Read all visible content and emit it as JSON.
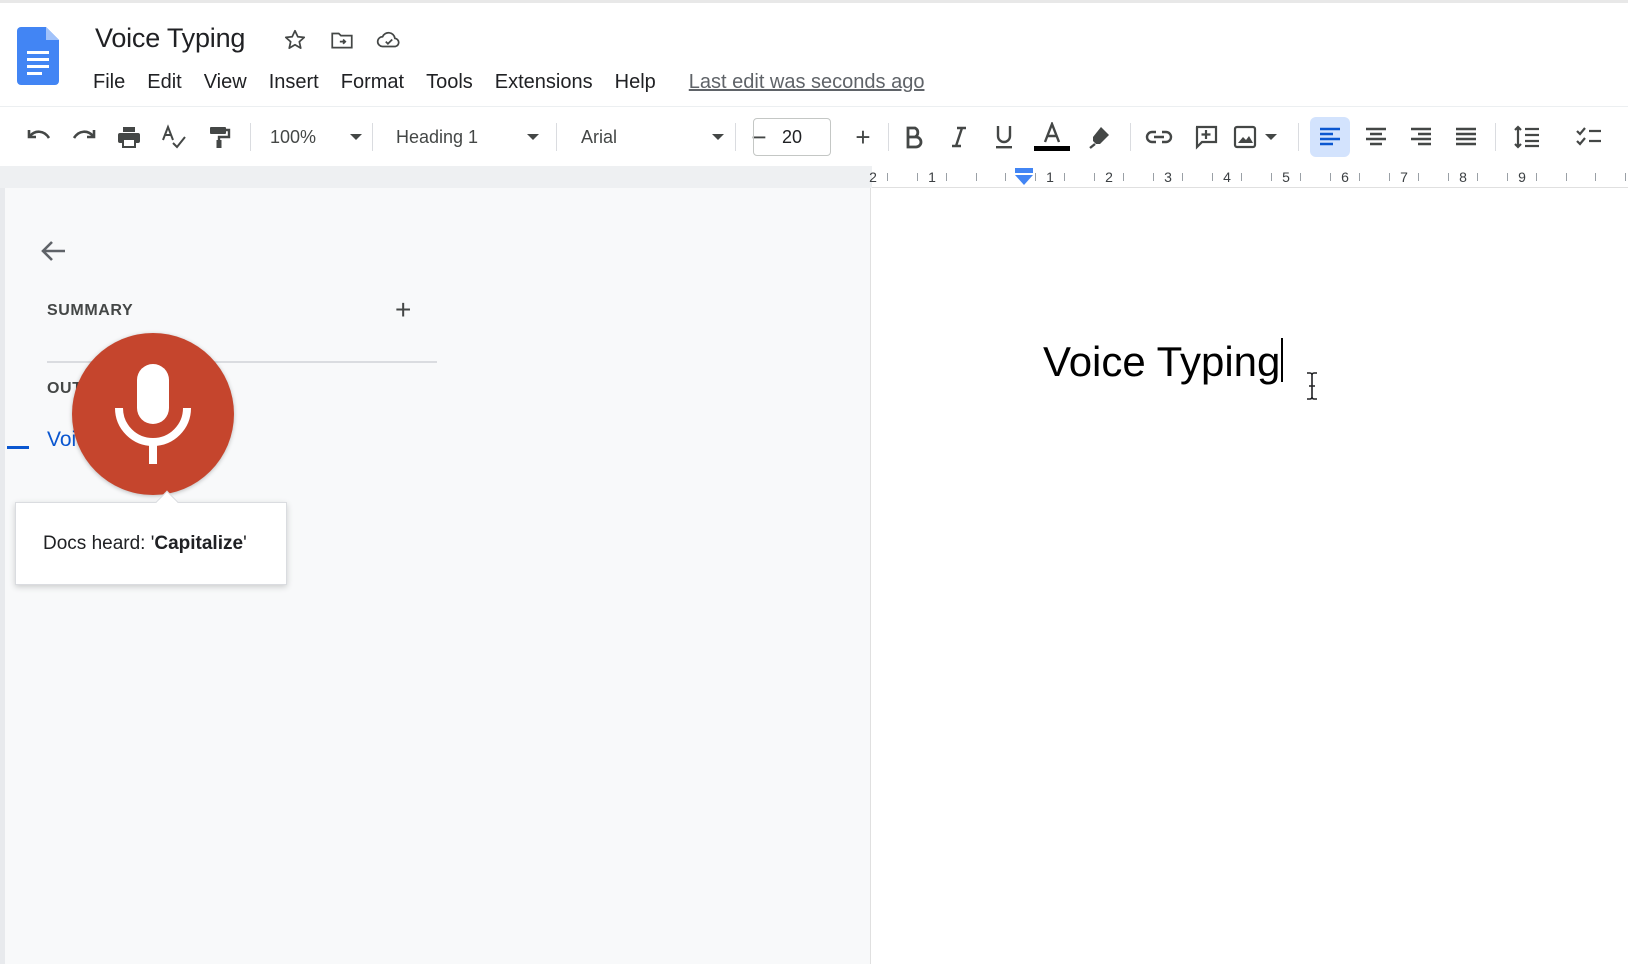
{
  "app": {
    "doc_title": "Voice Typing",
    "last_edit": "Last edit was seconds ago"
  },
  "menu": [
    "File",
    "Edit",
    "View",
    "Insert",
    "Format",
    "Tools",
    "Extensions",
    "Help"
  ],
  "toolbar": {
    "zoom": "100%",
    "style": "Heading 1",
    "font": "Arial",
    "font_size": "20",
    "minus": "−",
    "plus": "+"
  },
  "ruler": [
    "2",
    "1",
    "1",
    "2",
    "3",
    "4",
    "5",
    "6",
    "7",
    "8",
    "9"
  ],
  "outline_panel": {
    "summary_label": "SUMMARY",
    "add_label": "+",
    "outline_label": "OUT",
    "outline_item": "Voic"
  },
  "voice_typing": {
    "heard_prefix": "Docs heard: '",
    "heard_word": "Capitalize",
    "heard_suffix": "'"
  },
  "document": {
    "heading": "Voice Typing"
  },
  "colors": {
    "mic_red": "#c5452d",
    "outline_blue": "#0b57d0",
    "docs_blue": "#4285f4",
    "active_align_bg": "#d3e3fd"
  },
  "icons": {
    "logo": "docs-logo-icon",
    "star": "star-icon",
    "move": "folder-move-icon",
    "cloud": "cloud-status-icon",
    "mic": "microphone-icon"
  }
}
